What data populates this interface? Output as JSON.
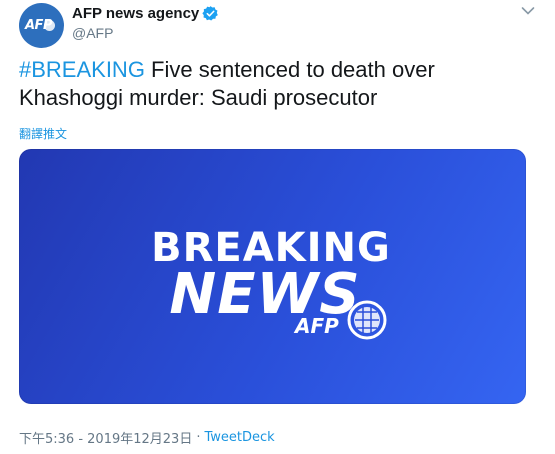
{
  "author": {
    "display_name": "AFP news agency",
    "handle": "@AFP",
    "verified": true,
    "avatar_logo_text": "AFP"
  },
  "tweet": {
    "hashtag": "#BREAKING",
    "text": " Five sentenced to death over Khashoggi murder: Saudi prosecutor"
  },
  "translate_label": "翻譯推文",
  "media": {
    "line1": "BREAKING",
    "line2": "NEWS",
    "logo_text": "AFP"
  },
  "meta": {
    "timestamp": "下午5:36 - 2019年12月23日",
    "separator": "·",
    "source": "TweetDeck"
  },
  "colors": {
    "link": "#1b95e0",
    "media_background": "#2a4fd9",
    "verified_badge": "#1da1f2",
    "avatar": "#2d6fbd"
  },
  "icons": [
    "verified-badge-icon",
    "chevron-down-icon",
    "globe-icon"
  ]
}
